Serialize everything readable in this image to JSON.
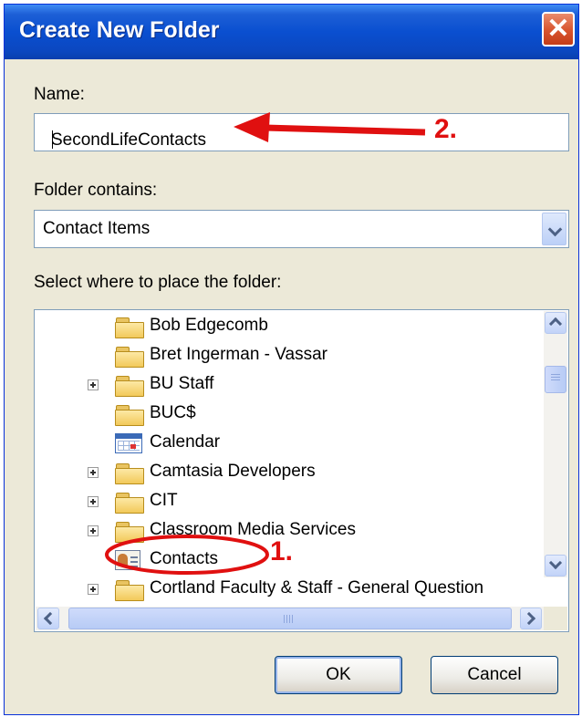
{
  "window": {
    "title": "Create New Folder"
  },
  "form": {
    "name_label": "Name:",
    "name_value": "SecondLifeContacts",
    "contains_label": "Folder contains:",
    "contains_value": "Contact Items",
    "place_label": "Select where to place the folder:"
  },
  "tree": {
    "items": [
      {
        "label": "Bob Edgecomb",
        "icon": "folder-icon",
        "expandable": false
      },
      {
        "label": "Bret Ingerman - Vassar",
        "icon": "folder-icon",
        "expandable": false
      },
      {
        "label": "BU Staff",
        "icon": "folder-icon",
        "expandable": true
      },
      {
        "label": "BUC$",
        "icon": "folder-icon",
        "expandable": false
      },
      {
        "label": "Calendar",
        "icon": "calendar-icon",
        "expandable": false
      },
      {
        "label": "Camtasia Developers",
        "icon": "folder-icon",
        "expandable": true
      },
      {
        "label": "CIT",
        "icon": "folder-icon",
        "expandable": true
      },
      {
        "label": "Classroom Media Services",
        "icon": "folder-icon",
        "expandable": true
      },
      {
        "label": "Contacts",
        "icon": "contacts-icon",
        "expandable": false
      },
      {
        "label": "Cortland Faculty & Staff - General Question",
        "icon": "folder-icon",
        "expandable": true
      }
    ]
  },
  "buttons": {
    "ok": "OK",
    "cancel": "Cancel"
  },
  "annotations": {
    "step1": "1.",
    "step2": "2.",
    "color": "#e01010"
  }
}
